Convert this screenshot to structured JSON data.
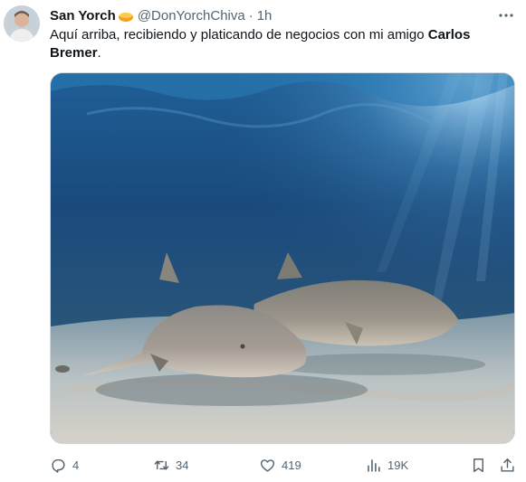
{
  "tweet": {
    "display_name": "San Yorch",
    "name_emoji": "orange-fruit-emoji",
    "handle": "@DonYorchChiva",
    "separator": "·",
    "time": "1h",
    "text_plain": "Aquí arriba, recibiendo y platicando de negocios con mi amigo ",
    "text_bold": "Carlos Bremer",
    "text_end": ".",
    "media_alt": "two-sharks-underwater-photo",
    "actions": {
      "replies": "4",
      "retweets": "34",
      "likes": "419",
      "views": "19K"
    }
  },
  "icons": {
    "more": "more-dots-icon",
    "reply": "reply-bubble-icon",
    "retweet": "retweet-arrows-icon",
    "like": "heart-icon",
    "views": "bar-chart-icon",
    "bookmark": "bookmark-icon",
    "share": "share-upload-icon"
  },
  "colors": {
    "text": "#0f1419",
    "secondary": "#536471",
    "border": "#cfd9de"
  }
}
